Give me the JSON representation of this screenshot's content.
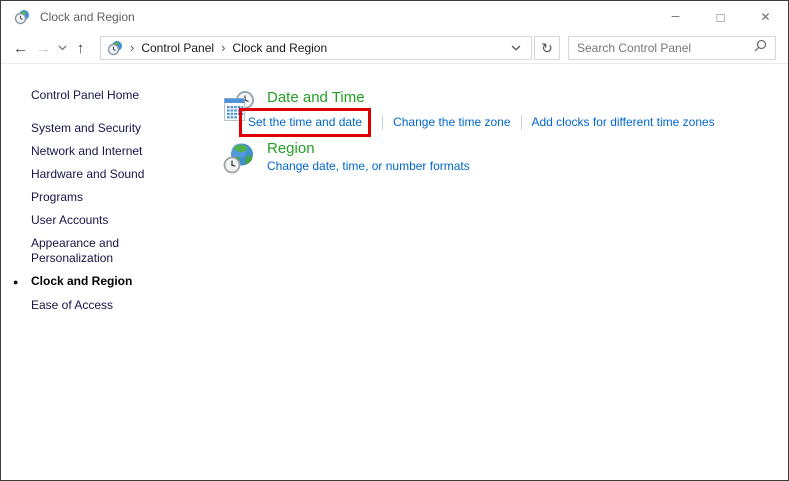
{
  "window": {
    "title": "Clock and Region"
  },
  "icons": {
    "minimize": "–",
    "maximize": "□",
    "close": "✕",
    "back": "←",
    "forward": "→",
    "up": "↑",
    "refresh": "↻",
    "breadcrumb_chevron": "›",
    "bullet": "●"
  },
  "toolbar": {
    "breadcrumb": {
      "items": [
        "Control Panel",
        "Clock and Region"
      ]
    },
    "search_placeholder": "Search Control Panel"
  },
  "sidebar": {
    "home": "Control Panel Home",
    "items": [
      "System and Security",
      "Network and Internet",
      "Hardware and Sound",
      "Programs",
      "User Accounts",
      "Appearance and Personalization",
      "Clock and Region",
      "Ease of Access"
    ],
    "active_item": "Clock and Region"
  },
  "main": {
    "sections": [
      {
        "title": "Date and Time",
        "links": [
          {
            "label": "Set the time and date",
            "highlighted": true
          },
          {
            "label": "Change the time zone",
            "highlighted": false
          },
          {
            "label": "Add clocks for different time zones",
            "highlighted": false
          }
        ]
      },
      {
        "title": "Region",
        "links": [
          {
            "label": "Change date, time, or number formats",
            "highlighted": false
          }
        ]
      }
    ]
  },
  "colors": {
    "heading_green": "#23a023",
    "link_blue": "#0066cc",
    "highlight_red": "#de0000",
    "sidebar_text": "#15154a",
    "border_gray": "#d9d9d9"
  }
}
